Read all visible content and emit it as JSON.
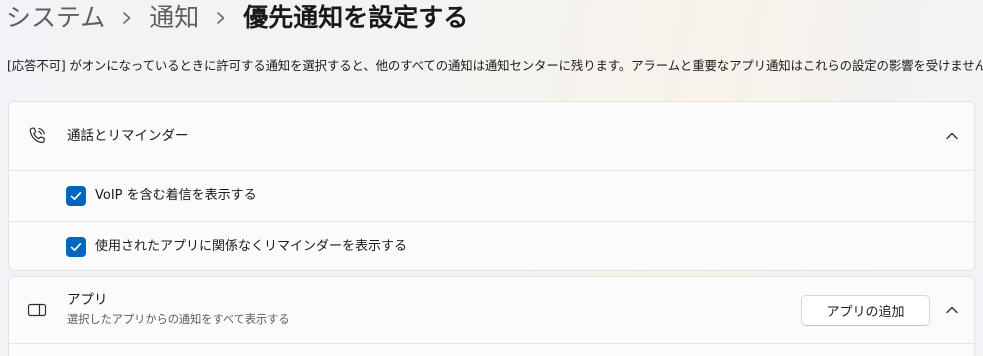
{
  "breadcrumb": {
    "items": [
      "システム",
      "通知"
    ],
    "current": "優先通知を設定する"
  },
  "description": "[応答不可] がオンになっているときに許可する通知を選択すると、他のすべての通知は通知センターに残ります。アラームと重要なアプリ通知はこれらの設定の影響を受けません。",
  "calls_section": {
    "title": "通話とリマインダー",
    "icon": "phone-icon",
    "expanded": true,
    "options": [
      {
        "label": "VoIP を含む着信を表示する",
        "checked": true
      },
      {
        "label": "使用されたアプリに関係なくリマインダーを表示する",
        "checked": true
      }
    ]
  },
  "apps_section": {
    "title": "アプリ",
    "subtitle": "選択したアプリからの通知をすべて表示する",
    "icon": "app-window-icon",
    "add_button_label": "アプリの追加",
    "expanded": true
  },
  "colors": {
    "accent": "#0067c0",
    "card_background": "#fbfbfb",
    "text_primary": "#1a1a1a",
    "text_secondary": "#5c5c5c"
  }
}
